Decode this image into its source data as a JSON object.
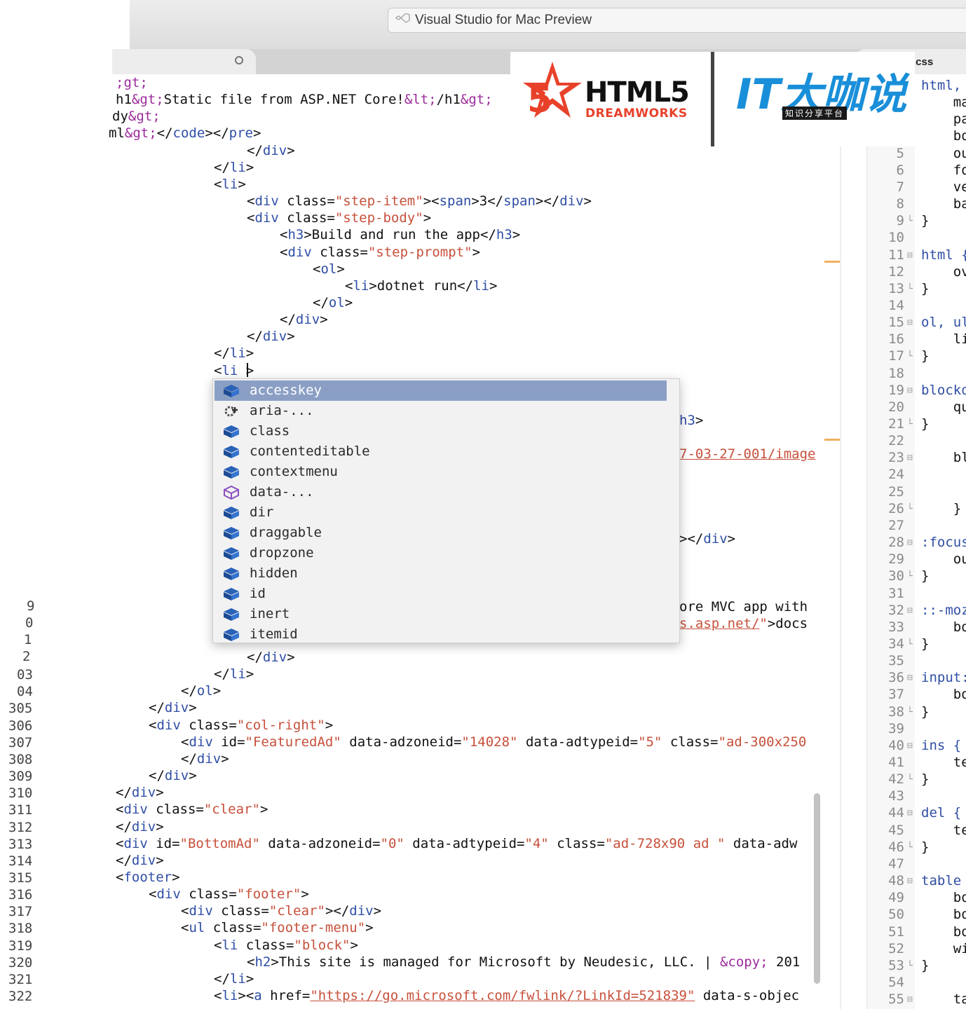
{
  "window": {
    "title": "Visual Studio for Mac Preview"
  },
  "tabs": {
    "right_tab_label": ".css"
  },
  "logos": {
    "html5_text": "HTML5",
    "html5_sub": "DREAMWORKS",
    "it_text": "IT大咖说",
    "it_sub": "知识分享平台"
  },
  "editor": {
    "lines": [
      {
        "parts": [
          [
            "p",
            ";gt;"
          ]
        ]
      },
      {
        "parts": [
          [
            "x",
            "h1"
          ],
          [
            "p",
            "&gt;"
          ],
          [
            "x",
            "Static file from ASP.NET Core!"
          ],
          [
            "p",
            "&lt;"
          ],
          [
            "x",
            "/h1"
          ],
          [
            "p",
            "&gt;"
          ]
        ]
      },
      {
        "parts": [
          [
            "x",
            "dy"
          ],
          [
            "p",
            "&gt;"
          ]
        ]
      },
      {
        "parts": [
          [
            "x",
            "ml"
          ],
          [
            "p",
            "&gt;"
          ],
          [
            "x",
            "</"
          ],
          [
            "t",
            "code"
          ],
          [
            "x",
            "></"
          ],
          [
            "t",
            "pre"
          ],
          [
            "x",
            ">"
          ]
        ]
      },
      {
        "parts": [
          [
            "x",
            "</"
          ],
          [
            "t",
            "div"
          ],
          [
            "x",
            ">"
          ]
        ]
      },
      {
        "parts": [
          [
            "x",
            "</"
          ],
          [
            "t",
            "li"
          ],
          [
            "x",
            ">"
          ]
        ]
      },
      {
        "parts": [
          [
            "x",
            "<"
          ],
          [
            "t",
            "li"
          ],
          [
            "x",
            ">"
          ]
        ]
      },
      {
        "parts": [
          [
            "x",
            "<"
          ],
          [
            "t",
            "div"
          ],
          [
            "x",
            " class="
          ],
          [
            "s",
            "\"step-item\""
          ],
          [
            "x",
            "><"
          ],
          [
            "t",
            "span"
          ],
          [
            "x",
            ">3</"
          ],
          [
            "t",
            "span"
          ],
          [
            "x",
            "></"
          ],
          [
            "t",
            "div"
          ],
          [
            "x",
            ">"
          ]
        ]
      },
      {
        "parts": [
          [
            "x",
            "<"
          ],
          [
            "t",
            "div"
          ],
          [
            "x",
            " class="
          ],
          [
            "s",
            "\"step-body\""
          ],
          [
            "x",
            ">"
          ]
        ]
      },
      {
        "parts": [
          [
            "x",
            "<"
          ],
          [
            "t",
            "h3"
          ],
          [
            "x",
            ">Build and run the app</"
          ],
          [
            "t",
            "h3"
          ],
          [
            "x",
            ">"
          ]
        ]
      },
      {
        "parts": [
          [
            "x",
            "<"
          ],
          [
            "t",
            "div"
          ],
          [
            "x",
            " class="
          ],
          [
            "s",
            "\"step-prompt\""
          ],
          [
            "x",
            ">"
          ]
        ]
      },
      {
        "parts": [
          [
            "x",
            "<"
          ],
          [
            "t",
            "ol"
          ],
          [
            "x",
            ">"
          ]
        ]
      },
      {
        "parts": [
          [
            "x",
            "<"
          ],
          [
            "t",
            "li"
          ],
          [
            "x",
            ">dotnet run</"
          ],
          [
            "t",
            "li"
          ],
          [
            "x",
            ">"
          ]
        ]
      },
      {
        "parts": [
          [
            "x",
            "</"
          ],
          [
            "t",
            "ol"
          ],
          [
            "x",
            ">"
          ]
        ]
      },
      {
        "parts": [
          [
            "x",
            "</"
          ],
          [
            "t",
            "div"
          ],
          [
            "x",
            ">"
          ]
        ]
      },
      {
        "parts": [
          [
            "x",
            "</"
          ],
          [
            "t",
            "div"
          ],
          [
            "x",
            ">"
          ]
        ]
      },
      {
        "parts": [
          [
            "x",
            "</"
          ],
          [
            "t",
            "li"
          ],
          [
            "x",
            ">"
          ]
        ]
      },
      {
        "parts": [
          [
            "x",
            "<"
          ],
          [
            "t",
            "li"
          ],
          [
            "x",
            " >"
          ]
        ]
      }
    ],
    "behind_popup": [
      {
        "parts": [
          [
            "t",
            "h3"
          ],
          [
            "x",
            ">"
          ]
        ]
      },
      {
        "parts": [
          [
            "u",
            "7-03-27-001/image"
          ]
        ]
      },
      {
        "parts": [
          [
            "x",
            "></"
          ],
          [
            "t",
            "div"
          ],
          [
            "x",
            ">"
          ]
        ]
      },
      {
        "parts": [
          [
            "x",
            "ore MVC app with"
          ]
        ]
      },
      {
        "parts": [
          [
            "u",
            "s.asp.net/"
          ],
          [
            "s",
            "\""
          ],
          [
            "x",
            ">docs"
          ]
        ]
      }
    ],
    "lower_lines": [
      {
        "num": "",
        "parts": [
          [
            "x",
            "</"
          ],
          [
            "t",
            "div"
          ],
          [
            "x",
            ">"
          ]
        ]
      },
      {
        "num": "03",
        "parts": [
          [
            "x",
            "</"
          ],
          [
            "t",
            "li"
          ],
          [
            "x",
            ">"
          ]
        ]
      },
      {
        "num": "04",
        "parts": [
          [
            "x",
            "</"
          ],
          [
            "t",
            "ol"
          ],
          [
            "x",
            ">"
          ]
        ]
      },
      {
        "num": "305",
        "parts": [
          [
            "x",
            "</"
          ],
          [
            "t",
            "div"
          ],
          [
            "x",
            ">"
          ]
        ]
      },
      {
        "num": "306",
        "parts": [
          [
            "x",
            "<"
          ],
          [
            "t",
            "div"
          ],
          [
            "x",
            " class="
          ],
          [
            "s",
            "\"col-right\""
          ],
          [
            "x",
            ">"
          ]
        ]
      },
      {
        "num": "307",
        "parts": [
          [
            "x",
            "<"
          ],
          [
            "t",
            "div"
          ],
          [
            "x",
            " id="
          ],
          [
            "s",
            "\"FeaturedAd\""
          ],
          [
            "x",
            " data-adzoneid="
          ],
          [
            "s",
            "\"14028\""
          ],
          [
            "x",
            " data-adtypeid="
          ],
          [
            "s",
            "\"5\""
          ],
          [
            "x",
            " class="
          ],
          [
            "s",
            "\"ad-300x250"
          ]
        ]
      },
      {
        "num": "308",
        "parts": [
          [
            "x",
            "</"
          ],
          [
            "t",
            "div"
          ],
          [
            "x",
            ">"
          ]
        ]
      },
      {
        "num": "309",
        "parts": [
          [
            "x",
            "</"
          ],
          [
            "t",
            "div"
          ],
          [
            "x",
            ">"
          ]
        ]
      },
      {
        "num": "310",
        "parts": [
          [
            "x",
            "</"
          ],
          [
            "t",
            "div"
          ],
          [
            "x",
            ">"
          ]
        ]
      },
      {
        "num": "311",
        "parts": [
          [
            "x",
            "<"
          ],
          [
            "t",
            "div"
          ],
          [
            "x",
            " class="
          ],
          [
            "s",
            "\"clear\""
          ],
          [
            "x",
            ">"
          ]
        ]
      },
      {
        "num": "312",
        "parts": [
          [
            "x",
            "</"
          ],
          [
            "t",
            "div"
          ],
          [
            "x",
            ">"
          ]
        ]
      },
      {
        "num": "313",
        "parts": [
          [
            "x",
            "<"
          ],
          [
            "t",
            "div"
          ],
          [
            "x",
            " id="
          ],
          [
            "s",
            "\"BottomAd\""
          ],
          [
            "x",
            " data-adzoneid="
          ],
          [
            "s",
            "\"0\""
          ],
          [
            "x",
            " data-adtypeid="
          ],
          [
            "s",
            "\"4\""
          ],
          [
            "x",
            " class="
          ],
          [
            "s",
            "\"ad-728x90 ad \""
          ],
          [
            "x",
            " data-adw"
          ]
        ]
      },
      {
        "num": "314",
        "parts": [
          [
            "x",
            "</"
          ],
          [
            "t",
            "div"
          ],
          [
            "x",
            ">"
          ]
        ]
      },
      {
        "num": "315",
        "parts": [
          [
            "x",
            "<"
          ],
          [
            "t",
            "footer"
          ],
          [
            "x",
            ">"
          ]
        ]
      },
      {
        "num": "316",
        "parts": [
          [
            "x",
            "<"
          ],
          [
            "t",
            "div"
          ],
          [
            "x",
            " class="
          ],
          [
            "s",
            "\"footer\""
          ],
          [
            "x",
            ">"
          ]
        ]
      },
      {
        "num": "317",
        "parts": [
          [
            "x",
            "<"
          ],
          [
            "t",
            "div"
          ],
          [
            "x",
            " class="
          ],
          [
            "s",
            "\"clear\""
          ],
          [
            "x",
            "></"
          ],
          [
            "t",
            "div"
          ],
          [
            "x",
            ">"
          ]
        ]
      },
      {
        "num": "318",
        "parts": [
          [
            "x",
            "<"
          ],
          [
            "t",
            "ul"
          ],
          [
            "x",
            " class="
          ],
          [
            "s",
            "\"footer-menu\""
          ],
          [
            "x",
            ">"
          ]
        ]
      },
      {
        "num": "319",
        "parts": [
          [
            "x",
            "<"
          ],
          [
            "t",
            "li"
          ],
          [
            "x",
            " class="
          ],
          [
            "s",
            "\"block\""
          ],
          [
            "x",
            ">"
          ]
        ]
      },
      {
        "num": "320",
        "parts": [
          [
            "x",
            "<"
          ],
          [
            "t",
            "h2"
          ],
          [
            "x",
            ">This site is managed for Microsoft by Neudesic, LLC. | "
          ],
          [
            "p",
            "&copy;"
          ],
          [
            "x",
            " 201"
          ]
        ]
      },
      {
        "num": "321",
        "parts": [
          [
            "x",
            "</"
          ],
          [
            "t",
            "li"
          ],
          [
            "x",
            ">"
          ]
        ]
      },
      {
        "num": "322",
        "parts": [
          [
            "x",
            "<"
          ],
          [
            "t",
            "li"
          ],
          [
            "x",
            "><"
          ],
          [
            "t",
            "a"
          ],
          [
            "x",
            " href="
          ],
          [
            "u",
            "\"https://go.microsoft.com/fwlink/?LinkId=521839\""
          ],
          [
            "x",
            " data-s-objec"
          ]
        ]
      }
    ],
    "left_gutter_partial": [
      "9",
      "0",
      "1",
      "2"
    ]
  },
  "completion": {
    "items": [
      {
        "label": "accesskey",
        "icon": "property-icon",
        "selected": true
      },
      {
        "label": "aria-...",
        "icon": "snippet-icon"
      },
      {
        "label": "class",
        "icon": "property-icon"
      },
      {
        "label": "contenteditable",
        "icon": "property-icon"
      },
      {
        "label": "contextmenu",
        "icon": "property-icon"
      },
      {
        "label": "data-...",
        "icon": "data-icon"
      },
      {
        "label": "dir",
        "icon": "property-icon"
      },
      {
        "label": "draggable",
        "icon": "property-icon"
      },
      {
        "label": "dropzone",
        "icon": "property-icon"
      },
      {
        "label": "hidden",
        "icon": "property-icon"
      },
      {
        "label": "id",
        "icon": "property-icon"
      },
      {
        "label": "inert",
        "icon": "property-icon"
      },
      {
        "label": "itemid",
        "icon": "property-icon"
      }
    ]
  },
  "css_pane": {
    "lines": [
      {
        "n": "",
        "f": "",
        "t": "html,"
      },
      {
        "n": "",
        "f": "",
        "t": "    ma"
      },
      {
        "n": "",
        "f": "",
        "t": "    pa"
      },
      {
        "n": "",
        "f": "",
        "t": "    bo"
      },
      {
        "n": "5",
        "f": "",
        "t": "    ou"
      },
      {
        "n": "6",
        "f": "",
        "t": "    fo"
      },
      {
        "n": "7",
        "f": "",
        "t": "    ve"
      },
      {
        "n": "8",
        "f": "",
        "t": "    ba"
      },
      {
        "n": "9",
        "f": "└",
        "t": "}"
      },
      {
        "n": "10",
        "f": "",
        "t": ""
      },
      {
        "n": "11",
        "f": "⊟",
        "t": "html {"
      },
      {
        "n": "12",
        "f": "",
        "t": "    ov"
      },
      {
        "n": "13",
        "f": "└",
        "t": "}"
      },
      {
        "n": "14",
        "f": "",
        "t": ""
      },
      {
        "n": "15",
        "f": "⊟",
        "t": "ol, ul"
      },
      {
        "n": "16",
        "f": "",
        "t": "    li"
      },
      {
        "n": "17",
        "f": "└",
        "t": "}"
      },
      {
        "n": "18",
        "f": "",
        "t": ""
      },
      {
        "n": "19",
        "f": "⊟",
        "t": "blockq"
      },
      {
        "n": "20",
        "f": "",
        "t": "    qu"
      },
      {
        "n": "21",
        "f": "└",
        "t": "}"
      },
      {
        "n": "22",
        "f": "",
        "t": ""
      },
      {
        "n": "23",
        "f": "⊟",
        "t": "    bl"
      },
      {
        "n": "24",
        "f": "",
        "t": ""
      },
      {
        "n": "25",
        "f": "",
        "t": ""
      },
      {
        "n": "26",
        "f": "└",
        "t": "    }"
      },
      {
        "n": "27",
        "f": "",
        "t": ""
      },
      {
        "n": "28",
        "f": "⊟",
        "t": ":focus"
      },
      {
        "n": "29",
        "f": "",
        "t": "    ou"
      },
      {
        "n": "30",
        "f": "└",
        "t": "}"
      },
      {
        "n": "31",
        "f": "",
        "t": ""
      },
      {
        "n": "32",
        "f": "⊟",
        "t": "::-moz"
      },
      {
        "n": "33",
        "f": "",
        "t": "    bo"
      },
      {
        "n": "34",
        "f": "└",
        "t": "}"
      },
      {
        "n": "35",
        "f": "",
        "t": ""
      },
      {
        "n": "36",
        "f": "⊟",
        "t": "input:"
      },
      {
        "n": "37",
        "f": "",
        "t": "    bo"
      },
      {
        "n": "38",
        "f": "└",
        "t": "}"
      },
      {
        "n": "39",
        "f": "",
        "t": ""
      },
      {
        "n": "40",
        "f": "⊟",
        "t": "ins {"
      },
      {
        "n": "41",
        "f": "",
        "t": "    te"
      },
      {
        "n": "42",
        "f": "└",
        "t": "}"
      },
      {
        "n": "43",
        "f": "",
        "t": ""
      },
      {
        "n": "44",
        "f": "⊟",
        "t": "del {"
      },
      {
        "n": "45",
        "f": "",
        "t": "    te"
      },
      {
        "n": "46",
        "f": "└",
        "t": "}"
      },
      {
        "n": "47",
        "f": "",
        "t": ""
      },
      {
        "n": "48",
        "f": "⊟",
        "t": "table"
      },
      {
        "n": "49",
        "f": "",
        "t": "    bo"
      },
      {
        "n": "50",
        "f": "",
        "t": "    bo"
      },
      {
        "n": "51",
        "f": "",
        "t": "    bo"
      },
      {
        "n": "52",
        "f": "",
        "t": "    wi"
      },
      {
        "n": "53",
        "f": "└",
        "t": "}"
      },
      {
        "n": "54",
        "f": "",
        "t": ""
      },
      {
        "n": "55",
        "f": "⊟",
        "t": "    ta"
      }
    ]
  },
  "colors": {
    "tag": "#2f4ea6",
    "string": "#c7503b",
    "entity": "#9b2c9b",
    "selection": "#8b9fc4",
    "accent_marker": "#f0b060"
  }
}
